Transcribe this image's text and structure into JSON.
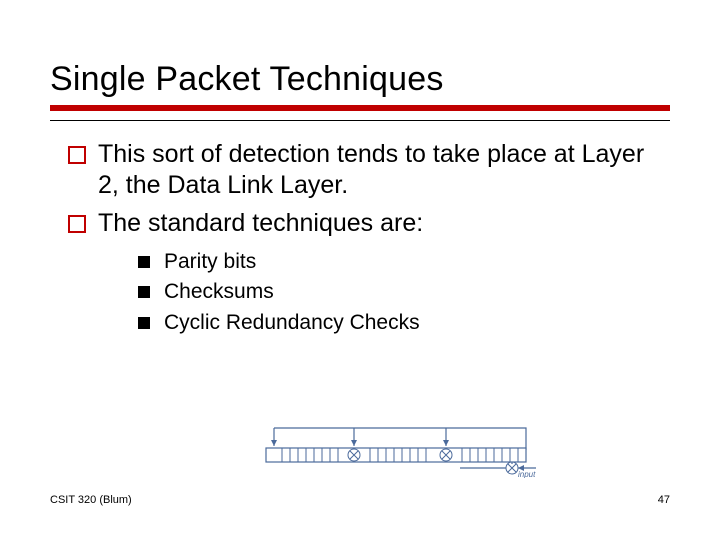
{
  "title": "Single Packet Techniques",
  "bullets": {
    "b0": "This sort of detection tends to take place at Layer 2, the Data Link Layer.",
    "b1": "The standard techniques are:"
  },
  "sub": {
    "s0": "Parity bits",
    "s1": "Checksums",
    "s2": "Cyclic Redundancy Checks"
  },
  "diagram": {
    "label": "input"
  },
  "footer": {
    "left": "CSIT 320 (Blum)",
    "right": "47"
  }
}
